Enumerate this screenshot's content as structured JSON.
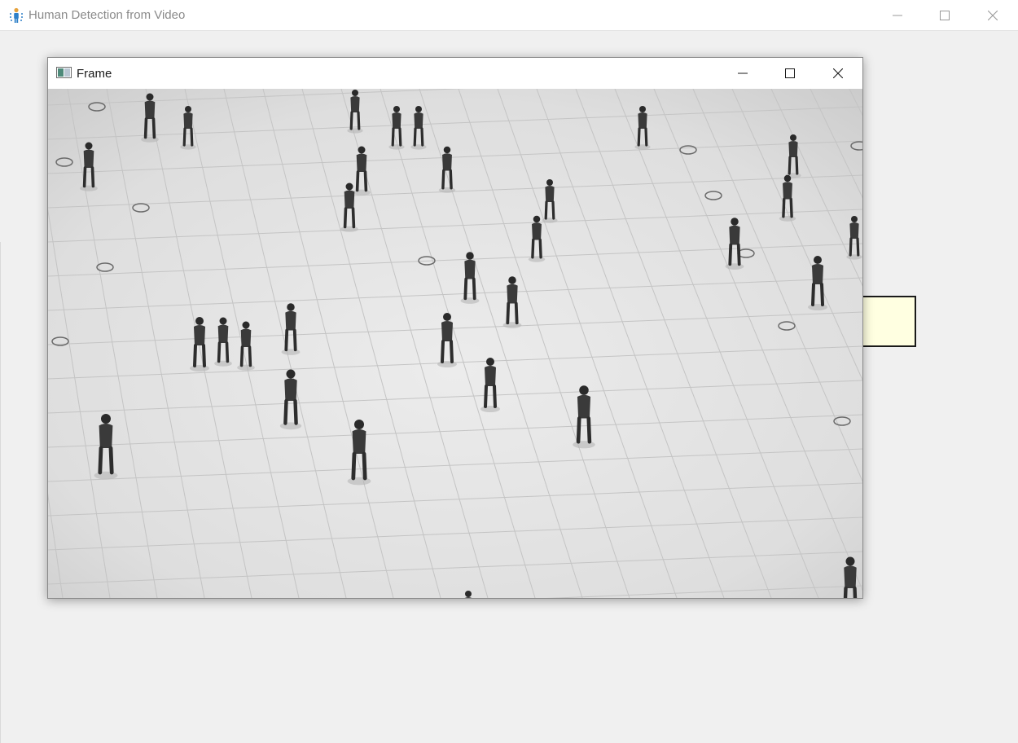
{
  "app": {
    "title": "Human Detection from Video",
    "icon": "person-icon",
    "controls": [
      "minimize-icon",
      "maximize-icon",
      "close-icon"
    ]
  },
  "frame_window": {
    "title": "Frame",
    "icon": "window-image-icon",
    "controls": [
      "minimize-icon",
      "maximize-icon",
      "close-icon"
    ],
    "content": "grayscale video frame of pedestrians walking on a tiled plaza"
  },
  "colors": {
    "app_background": "#f0f0f0",
    "titlebar": "#ffffff",
    "yellow_box_fill": "#ffffe1",
    "yellow_box_border": "#1a1a1a"
  }
}
